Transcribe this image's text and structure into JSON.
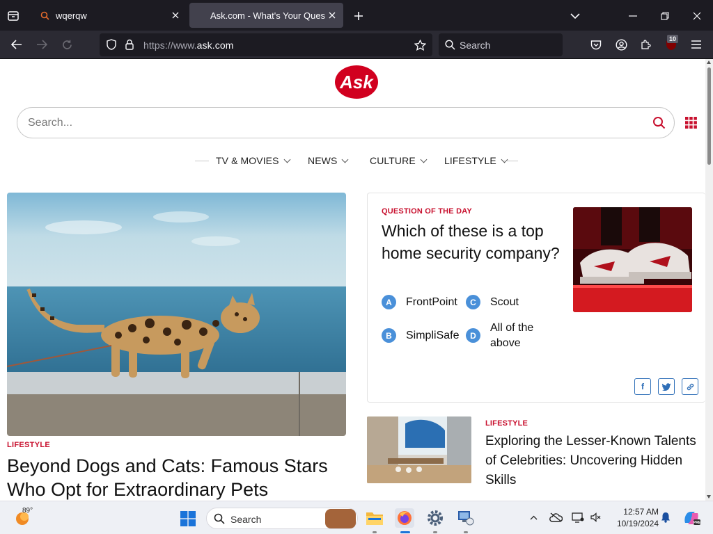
{
  "browser": {
    "tabs": [
      {
        "title": "wqerqw"
      },
      {
        "title": "Ask.com - What's Your Question"
      }
    ],
    "url_prefix": "https://www.",
    "url_domain": "ask.com",
    "search_placeholder": "Search",
    "extension_badge": "10"
  },
  "site": {
    "logo_text": "Ask",
    "search_placeholder": "Search...",
    "nav": [
      {
        "label": "TV & MOVIES"
      },
      {
        "label": "NEWS"
      },
      {
        "label": "CULTURE"
      },
      {
        "label": "LIFESTYLE"
      }
    ],
    "hero": {
      "category": "LIFESTYLE",
      "title": "Beyond Dogs and Cats: Famous Stars Who Opt for Extraordinary Pets"
    },
    "qotd": {
      "label": "QUESTION OF THE DAY",
      "question": "Which of these is a top home security company?",
      "options": [
        {
          "letter": "A",
          "text": "FrontPoint"
        },
        {
          "letter": "B",
          "text": "SimpliSafe"
        },
        {
          "letter": "C",
          "text": "Scout"
        },
        {
          "letter": "D",
          "text": "All of the above"
        }
      ],
      "share": {
        "facebook": "f",
        "twitter": "t",
        "link": "link"
      }
    },
    "article2": {
      "category": "LIFESTYLE",
      "title": "Exploring the Lesser-Known Talents of Celebrities: Uncovering Hidden Skills"
    }
  },
  "taskbar": {
    "weather_temp": "89°",
    "search_placeholder": "Search",
    "time": "12:57 AM",
    "date": "10/19/2024"
  },
  "colors": {
    "accent_red": "#c8102e",
    "option_blue": "#4a90d9",
    "chrome_dark": "#1c1b22"
  }
}
